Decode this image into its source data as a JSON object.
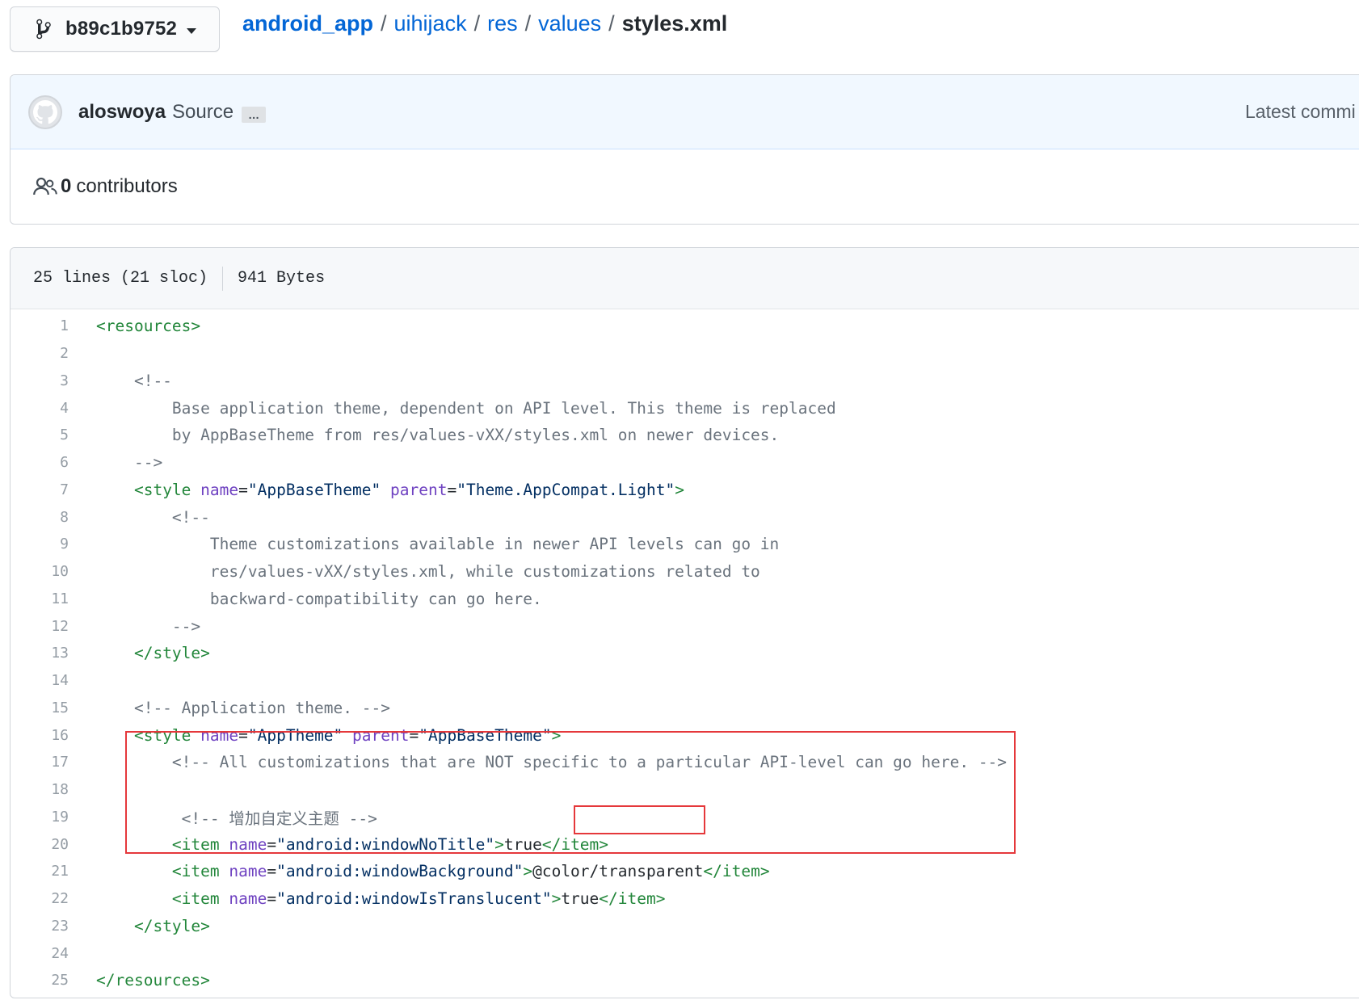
{
  "branch": {
    "name": "b89c1b9752",
    "icon": "git-branch-icon"
  },
  "breadcrumb": {
    "repo": "android_app",
    "parts": [
      "uihijack",
      "res",
      "values"
    ],
    "file": "styles.xml",
    "separator": "/"
  },
  "commit": {
    "author": "aloswoya",
    "message": "Source",
    "ellipsis": "…",
    "latest_label": "Latest commi"
  },
  "contributors": {
    "count": "0",
    "label": "contributors"
  },
  "file_info": {
    "lines": "25 lines (21 sloc)",
    "size": "941 Bytes"
  },
  "code_lines": [
    "<resources>",
    "",
    "    <!--",
    "        Base application theme, dependent on API level. This theme is replaced",
    "        by AppBaseTheme from res/values-vXX/styles.xml on newer devices.",
    "    -->",
    "    <style name=\"AppBaseTheme\" parent=\"Theme.AppCompat.Light\">",
    "        <!--",
    "            Theme customizations available in newer API levels can go in",
    "            res/values-vXX/styles.xml, while customizations related to",
    "            backward-compatibility can go here.",
    "        -->",
    "    </style>",
    "",
    "    <!-- Application theme. -->",
    "    <style name=\"AppTheme\" parent=\"AppBaseTheme\">",
    "        <!-- All customizations that are NOT specific to a particular API-level can go here. -->",
    "",
    "         <!-- 增加自定义主题 -->",
    "        <item name=\"android:windowNoTitle\">true</item>",
    "        <item name=\"android:windowBackground\">@color/transparent</item>",
    "        <item name=\"android:windowIsTranslucent\">true</item>",
    "    </style>",
    "",
    "</resources>"
  ],
  "highlight_color": "#e5383b"
}
